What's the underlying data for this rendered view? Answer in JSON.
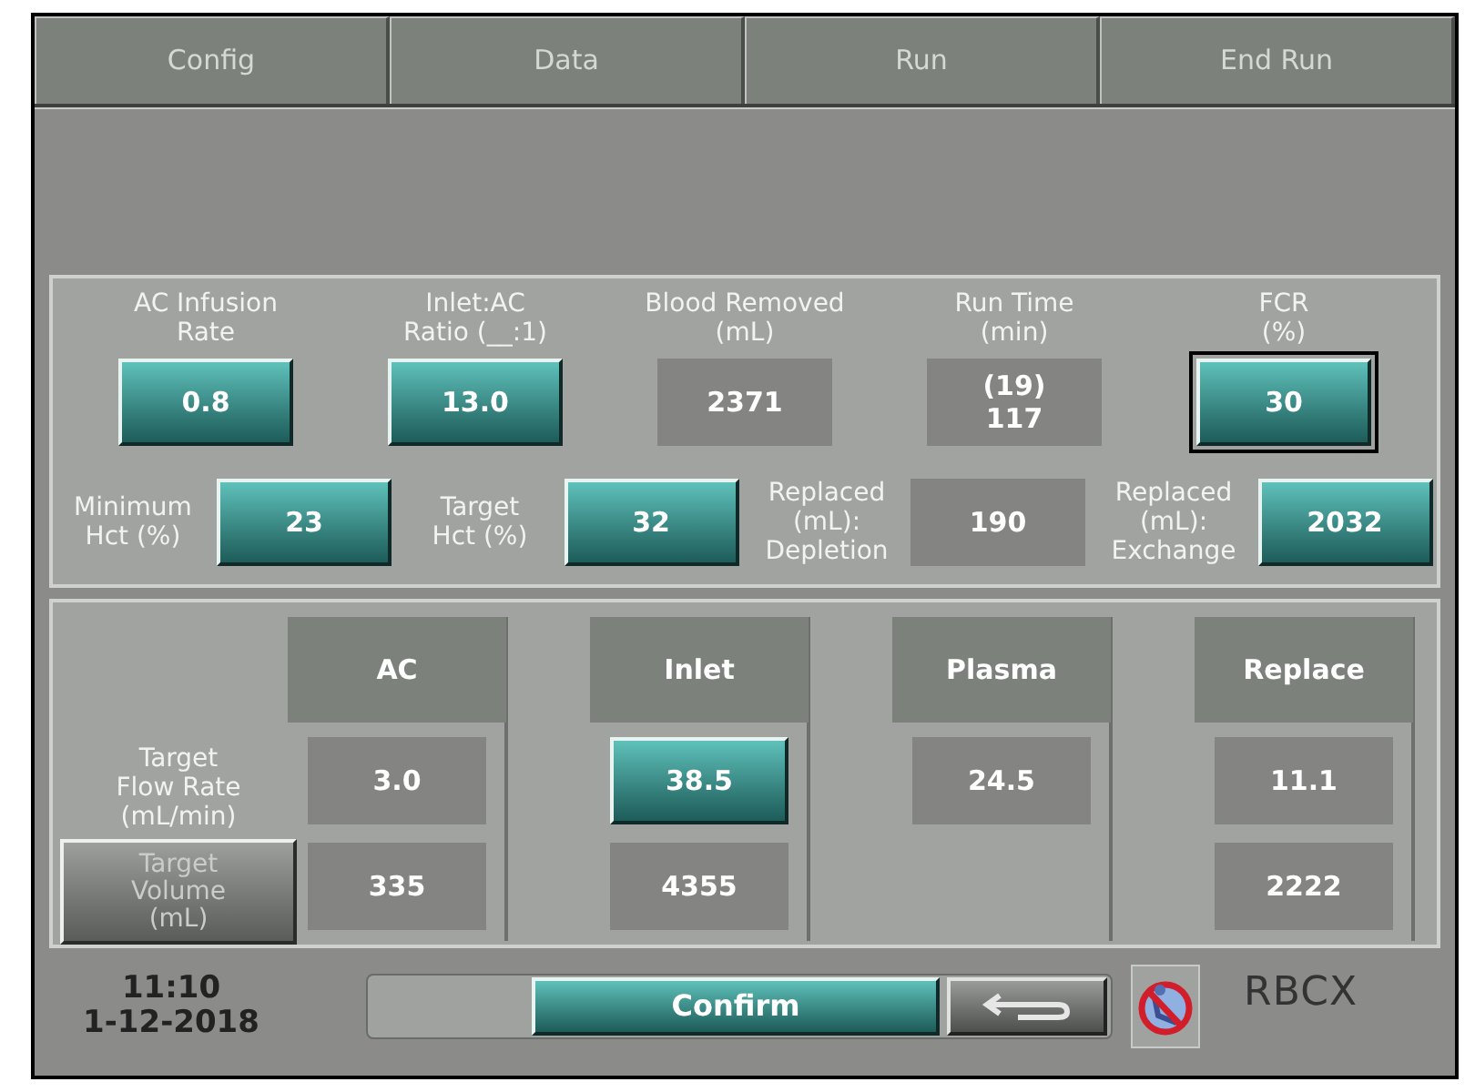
{
  "tabs": [
    {
      "label": "Config"
    },
    {
      "label": "Data"
    },
    {
      "label": "Run"
    },
    {
      "label": "End Run"
    }
  ],
  "top_row": [
    {
      "label": "AC Infusion\nRate",
      "value": "0.8",
      "kind": "button",
      "focused": false
    },
    {
      "label": "Inlet:AC\nRatio (__:1)",
      "value": "13.0",
      "kind": "button",
      "focused": false
    },
    {
      "label": "Blood Removed\n(mL)",
      "value": "2371",
      "kind": "display",
      "focused": false
    },
    {
      "label": "Run Time\n(min)",
      "value": "(19)\n117",
      "kind": "display",
      "focused": false
    },
    {
      "label": "FCR\n(%)",
      "value": "30",
      "kind": "button",
      "focused": true
    }
  ],
  "second_row": [
    {
      "label": "Minimum\nHct (%)",
      "value": "23",
      "kind": "button"
    },
    {
      "label": "Target\nHct (%)",
      "value": "32",
      "kind": "button"
    },
    {
      "label": "Replaced\n(mL):\nDepletion",
      "value": "190",
      "kind": "display"
    },
    {
      "label": "Replaced\n(mL):\nExchange",
      "value": "2032",
      "kind": "button"
    }
  ],
  "flow_table": {
    "columns": [
      "AC",
      "Inlet",
      "Plasma",
      "Replace"
    ],
    "rows": [
      {
        "label": "Target\nFlow Rate\n(mL/min)",
        "kind": "text",
        "cells": [
          {
            "value": "3.0",
            "kind": "display"
          },
          {
            "value": "38.5",
            "kind": "button"
          },
          {
            "value": "24.5",
            "kind": "display"
          },
          {
            "value": "11.1",
            "kind": "display"
          }
        ]
      },
      {
        "label": "Target\nVolume\n(mL)",
        "kind": "button",
        "cells": [
          {
            "value": "335",
            "kind": "display"
          },
          {
            "value": "4355",
            "kind": "display"
          },
          null,
          {
            "value": "2222",
            "kind": "display"
          }
        ]
      }
    ]
  },
  "footer": {
    "time": "11:10",
    "date": "1-12-2018",
    "confirm": "Confirm",
    "mode": "RBCX"
  }
}
